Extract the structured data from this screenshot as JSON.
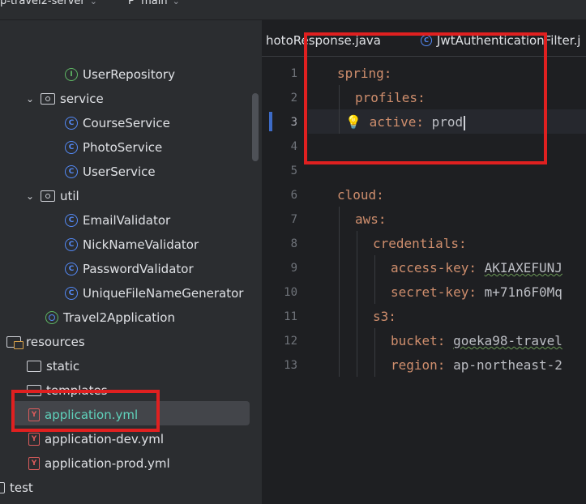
{
  "topbar": {
    "project": "p-travel2-server",
    "branch_icon": "P",
    "branch": "main"
  },
  "tabs": [
    {
      "label": "hotoResponse.java"
    },
    {
      "label": "JwtAuthenticationFilter.j",
      "icon": "class-icon"
    }
  ],
  "tree": [
    {
      "label": "UserRepository",
      "icon": "interface-icon"
    },
    {
      "label": "service",
      "icon": "package-icon",
      "expanded": true
    },
    {
      "label": "CourseService",
      "icon": "class-icon"
    },
    {
      "label": "PhotoService",
      "icon": "class-icon"
    },
    {
      "label": "UserService",
      "icon": "class-icon"
    },
    {
      "label": "util",
      "icon": "package-icon",
      "expanded": true
    },
    {
      "label": "EmailValidator",
      "icon": "class-icon"
    },
    {
      "label": "NickNameValidator",
      "icon": "class-icon"
    },
    {
      "label": "PasswordValidator",
      "icon": "class-icon"
    },
    {
      "label": "UniqueFileNameGenerator",
      "icon": "class-icon"
    },
    {
      "label": "Travel2Application",
      "icon": "spring-app-icon"
    },
    {
      "label": "resources",
      "icon": "resources-folder-icon"
    },
    {
      "label": "static",
      "icon": "folder-icon"
    },
    {
      "label": "templates",
      "icon": "folder-icon"
    },
    {
      "label": "application.yml",
      "icon": "yaml-icon",
      "selected": true
    },
    {
      "label": "application-dev.yml",
      "icon": "yaml-icon"
    },
    {
      "label": "application-prod.yml",
      "icon": "yaml-icon"
    },
    {
      "label": "test",
      "icon": "folder-icon"
    }
  ],
  "editor": {
    "line_numbers": [
      "1",
      "2",
      "3",
      "4",
      "5",
      "6",
      "7",
      "8",
      "9",
      "10",
      "11",
      "12",
      "13"
    ],
    "current_line": 3,
    "lines": {
      "l1_key": "spring",
      "l2_key": "profiles",
      "l3_key": "active",
      "l3_val": "prod",
      "l6_key": "cloud",
      "l7_key": "aws",
      "l8_key": "credentials",
      "l9_key": "access-key",
      "l9_val": "AKIAXEFUNJ",
      "l10_key": "secret-key",
      "l10_val": "m+71n6F0Mq",
      "l11_key": "s3",
      "l12_key": "bucket",
      "l12_val": "goeka98-travel",
      "l13_key": "region",
      "l13_val": "ap-northeast-2"
    }
  },
  "glyphs": {
    "class": "C",
    "interface": "I",
    "yaml": "Y",
    "colon": ":",
    "arrow": "⌄",
    "chevron": "⌄",
    "bulb": "💡"
  },
  "colors": {
    "highlight_box": "#e02020",
    "selected_label": "#5fd3bc",
    "yaml_key": "#cf8e6d"
  }
}
